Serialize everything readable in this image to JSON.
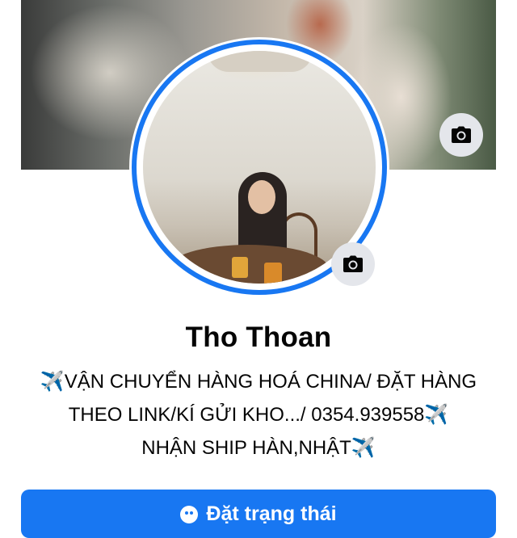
{
  "profile": {
    "name": "Tho Thoan",
    "bio_lines": [
      "✈️VẬN CHUYỂN HÀNG HOÁ CHINA/ ĐẶT HÀNG",
      "THEO LINK/KÍ GỬI KHO.../ 0354.939558✈️",
      "NHẬN SHIP HÀN,NHẬT✈️"
    ]
  },
  "actions": {
    "status_label": "Đặt trạng thái"
  },
  "icons": {
    "cover_camera": "camera-icon",
    "avatar_camera": "camera-icon",
    "status": "emoji-icon"
  },
  "colors": {
    "accent": "#1877f2",
    "camera_bg": "#e4e6eb",
    "text": "#050505"
  }
}
